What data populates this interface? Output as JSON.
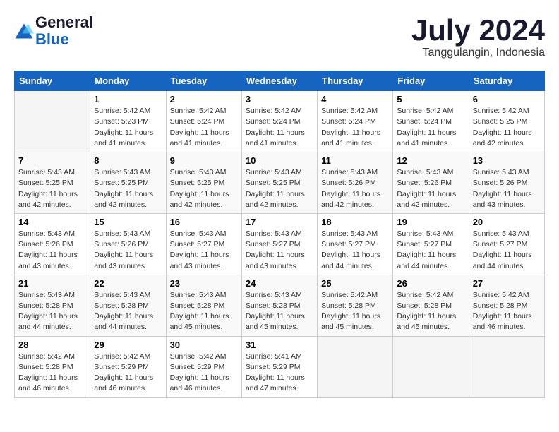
{
  "logo": {
    "general": "General",
    "blue": "Blue"
  },
  "title": "July 2024",
  "subtitle": "Tanggulangin, Indonesia",
  "days_header": [
    "Sunday",
    "Monday",
    "Tuesday",
    "Wednesday",
    "Thursday",
    "Friday",
    "Saturday"
  ],
  "weeks": [
    [
      {
        "day": "",
        "detail": ""
      },
      {
        "day": "1",
        "detail": "Sunrise: 5:42 AM\nSunset: 5:23 PM\nDaylight: 11 hours\nand 41 minutes."
      },
      {
        "day": "2",
        "detail": "Sunrise: 5:42 AM\nSunset: 5:24 PM\nDaylight: 11 hours\nand 41 minutes."
      },
      {
        "day": "3",
        "detail": "Sunrise: 5:42 AM\nSunset: 5:24 PM\nDaylight: 11 hours\nand 41 minutes."
      },
      {
        "day": "4",
        "detail": "Sunrise: 5:42 AM\nSunset: 5:24 PM\nDaylight: 11 hours\nand 41 minutes."
      },
      {
        "day": "5",
        "detail": "Sunrise: 5:42 AM\nSunset: 5:24 PM\nDaylight: 11 hours\nand 41 minutes."
      },
      {
        "day": "6",
        "detail": "Sunrise: 5:42 AM\nSunset: 5:25 PM\nDaylight: 11 hours\nand 42 minutes."
      }
    ],
    [
      {
        "day": "7",
        "detail": "Sunrise: 5:43 AM\nSunset: 5:25 PM\nDaylight: 11 hours\nand 42 minutes."
      },
      {
        "day": "8",
        "detail": "Sunrise: 5:43 AM\nSunset: 5:25 PM\nDaylight: 11 hours\nand 42 minutes."
      },
      {
        "day": "9",
        "detail": "Sunrise: 5:43 AM\nSunset: 5:25 PM\nDaylight: 11 hours\nand 42 minutes."
      },
      {
        "day": "10",
        "detail": "Sunrise: 5:43 AM\nSunset: 5:25 PM\nDaylight: 11 hours\nand 42 minutes."
      },
      {
        "day": "11",
        "detail": "Sunrise: 5:43 AM\nSunset: 5:26 PM\nDaylight: 11 hours\nand 42 minutes."
      },
      {
        "day": "12",
        "detail": "Sunrise: 5:43 AM\nSunset: 5:26 PM\nDaylight: 11 hours\nand 42 minutes."
      },
      {
        "day": "13",
        "detail": "Sunrise: 5:43 AM\nSunset: 5:26 PM\nDaylight: 11 hours\nand 43 minutes."
      }
    ],
    [
      {
        "day": "14",
        "detail": "Sunrise: 5:43 AM\nSunset: 5:26 PM\nDaylight: 11 hours\nand 43 minutes."
      },
      {
        "day": "15",
        "detail": "Sunrise: 5:43 AM\nSunset: 5:26 PM\nDaylight: 11 hours\nand 43 minutes."
      },
      {
        "day": "16",
        "detail": "Sunrise: 5:43 AM\nSunset: 5:27 PM\nDaylight: 11 hours\nand 43 minutes."
      },
      {
        "day": "17",
        "detail": "Sunrise: 5:43 AM\nSunset: 5:27 PM\nDaylight: 11 hours\nand 43 minutes."
      },
      {
        "day": "18",
        "detail": "Sunrise: 5:43 AM\nSunset: 5:27 PM\nDaylight: 11 hours\nand 44 minutes."
      },
      {
        "day": "19",
        "detail": "Sunrise: 5:43 AM\nSunset: 5:27 PM\nDaylight: 11 hours\nand 44 minutes."
      },
      {
        "day": "20",
        "detail": "Sunrise: 5:43 AM\nSunset: 5:27 PM\nDaylight: 11 hours\nand 44 minutes."
      }
    ],
    [
      {
        "day": "21",
        "detail": "Sunrise: 5:43 AM\nSunset: 5:28 PM\nDaylight: 11 hours\nand 44 minutes."
      },
      {
        "day": "22",
        "detail": "Sunrise: 5:43 AM\nSunset: 5:28 PM\nDaylight: 11 hours\nand 44 minutes."
      },
      {
        "day": "23",
        "detail": "Sunrise: 5:43 AM\nSunset: 5:28 PM\nDaylight: 11 hours\nand 45 minutes."
      },
      {
        "day": "24",
        "detail": "Sunrise: 5:43 AM\nSunset: 5:28 PM\nDaylight: 11 hours\nand 45 minutes."
      },
      {
        "day": "25",
        "detail": "Sunrise: 5:42 AM\nSunset: 5:28 PM\nDaylight: 11 hours\nand 45 minutes."
      },
      {
        "day": "26",
        "detail": "Sunrise: 5:42 AM\nSunset: 5:28 PM\nDaylight: 11 hours\nand 45 minutes."
      },
      {
        "day": "27",
        "detail": "Sunrise: 5:42 AM\nSunset: 5:28 PM\nDaylight: 11 hours\nand 46 minutes."
      }
    ],
    [
      {
        "day": "28",
        "detail": "Sunrise: 5:42 AM\nSunset: 5:28 PM\nDaylight: 11 hours\nand 46 minutes."
      },
      {
        "day": "29",
        "detail": "Sunrise: 5:42 AM\nSunset: 5:29 PM\nDaylight: 11 hours\nand 46 minutes."
      },
      {
        "day": "30",
        "detail": "Sunrise: 5:42 AM\nSunset: 5:29 PM\nDaylight: 11 hours\nand 46 minutes."
      },
      {
        "day": "31",
        "detail": "Sunrise: 5:41 AM\nSunset: 5:29 PM\nDaylight: 11 hours\nand 47 minutes."
      },
      {
        "day": "",
        "detail": ""
      },
      {
        "day": "",
        "detail": ""
      },
      {
        "day": "",
        "detail": ""
      }
    ]
  ]
}
